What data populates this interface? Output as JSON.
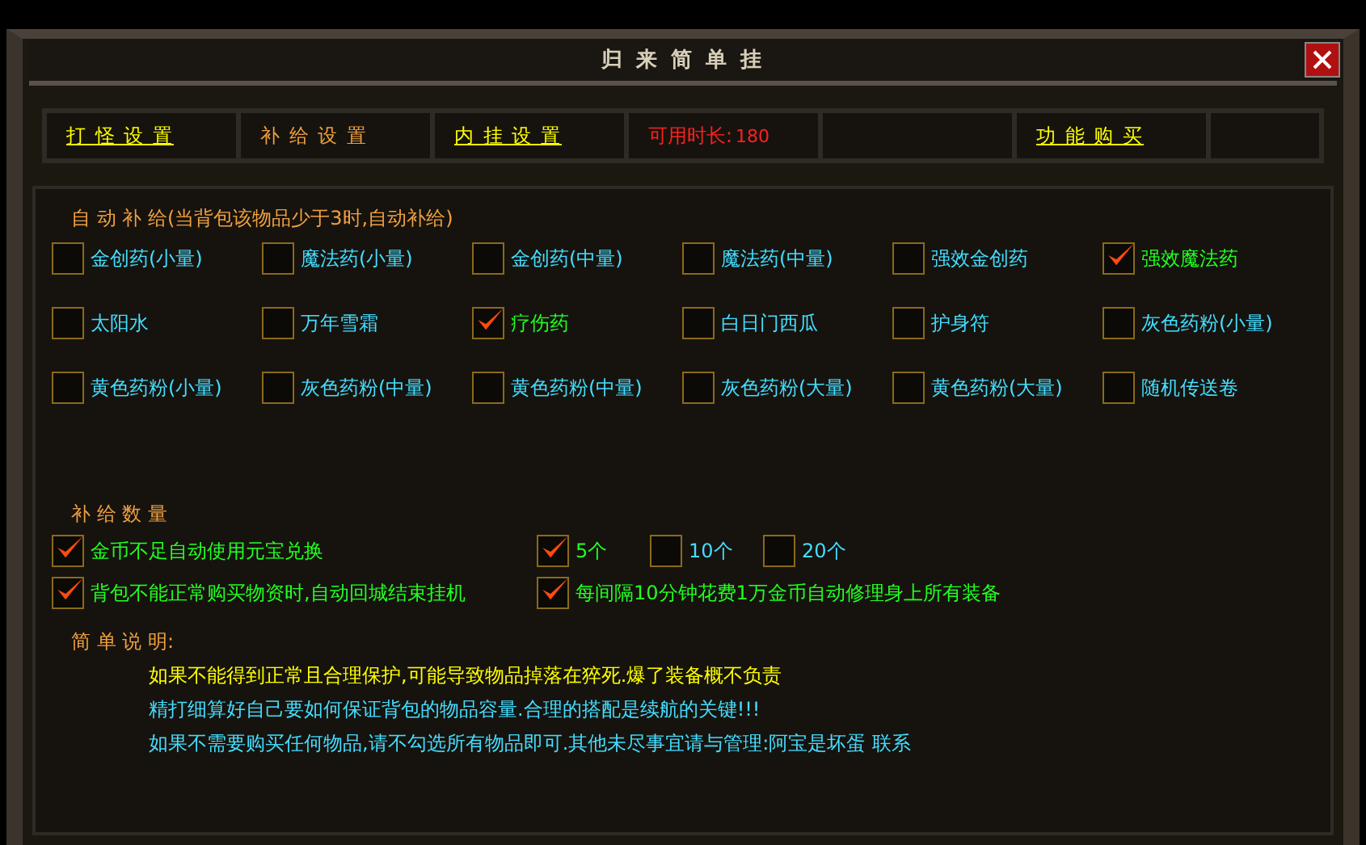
{
  "window": {
    "title": "归 来 简 单 挂"
  },
  "tabs": [
    {
      "kind": "link",
      "label": "打 怪 设 置",
      "selected": false
    },
    {
      "kind": "link",
      "label": "补 给 设 置",
      "selected": true
    },
    {
      "kind": "link",
      "label": "内 挂 设 置",
      "selected": false
    },
    {
      "kind": "info",
      "label": "可用时长:",
      "value": "180"
    },
    {
      "kind": "blank"
    },
    {
      "kind": "link",
      "label": "功 能 购 买",
      "selected": false
    },
    {
      "kind": "blank"
    }
  ],
  "supply": {
    "title": "自 动 补 给(当背包该物品少于3时,自动补给)",
    "items": [
      {
        "label": "金创药(小量)",
        "checked": false
      },
      {
        "label": "魔法药(小量)",
        "checked": false
      },
      {
        "label": "金创药(中量)",
        "checked": false
      },
      {
        "label": "魔法药(中量)",
        "checked": false
      },
      {
        "label": "强效金创药",
        "checked": false
      },
      {
        "label": "强效魔法药",
        "checked": true
      },
      {
        "label": "太阳水",
        "checked": false
      },
      {
        "label": "万年雪霜",
        "checked": false
      },
      {
        "label": "疗伤药",
        "checked": true
      },
      {
        "label": "白日门西瓜",
        "checked": false
      },
      {
        "label": "护身符",
        "checked": false
      },
      {
        "label": "灰色药粉(小量)",
        "checked": false
      },
      {
        "label": "黄色药粉(小量)",
        "checked": false
      },
      {
        "label": "灰色药粉(中量)",
        "checked": false
      },
      {
        "label": "黄色药粉(中量)",
        "checked": false
      },
      {
        "label": "灰色药粉(大量)",
        "checked": false
      },
      {
        "label": "黄色药粉(大量)",
        "checked": false
      },
      {
        "label": "随机传送卷",
        "checked": false
      }
    ]
  },
  "quantity": {
    "title": "补 给 数 量",
    "left": [
      {
        "label": "金币不足自动使用元宝兑换",
        "checked": true
      },
      {
        "label": "背包不能正常购买物资时,自动回城结束挂机",
        "checked": true
      }
    ],
    "amounts": [
      {
        "label": "5个",
        "checked": true
      },
      {
        "label": "10个",
        "checked": false
      },
      {
        "label": "20个",
        "checked": false
      }
    ],
    "repair": {
      "label": "每间隔10分钟花费1万金币自动修理身上所有装备",
      "checked": true
    }
  },
  "notes": {
    "title": "简 单 说 明:",
    "lines": [
      {
        "text": "如果不能得到正常且合理保护,可能导致物品掉落在猝死.爆了装备概不负责",
        "color": "#ffff00"
      },
      {
        "text": "精打细算好自己要如何保证背包的物品容量.合理的搭配是续航的关键!!!",
        "color": "#44ddff"
      },
      {
        "text": "如果不需要购买任何物品,请不勾选所有物品即可.其他未尽事宜请与管理:阿宝是坏蛋 联系",
        "color": "#44ddff"
      }
    ]
  }
}
